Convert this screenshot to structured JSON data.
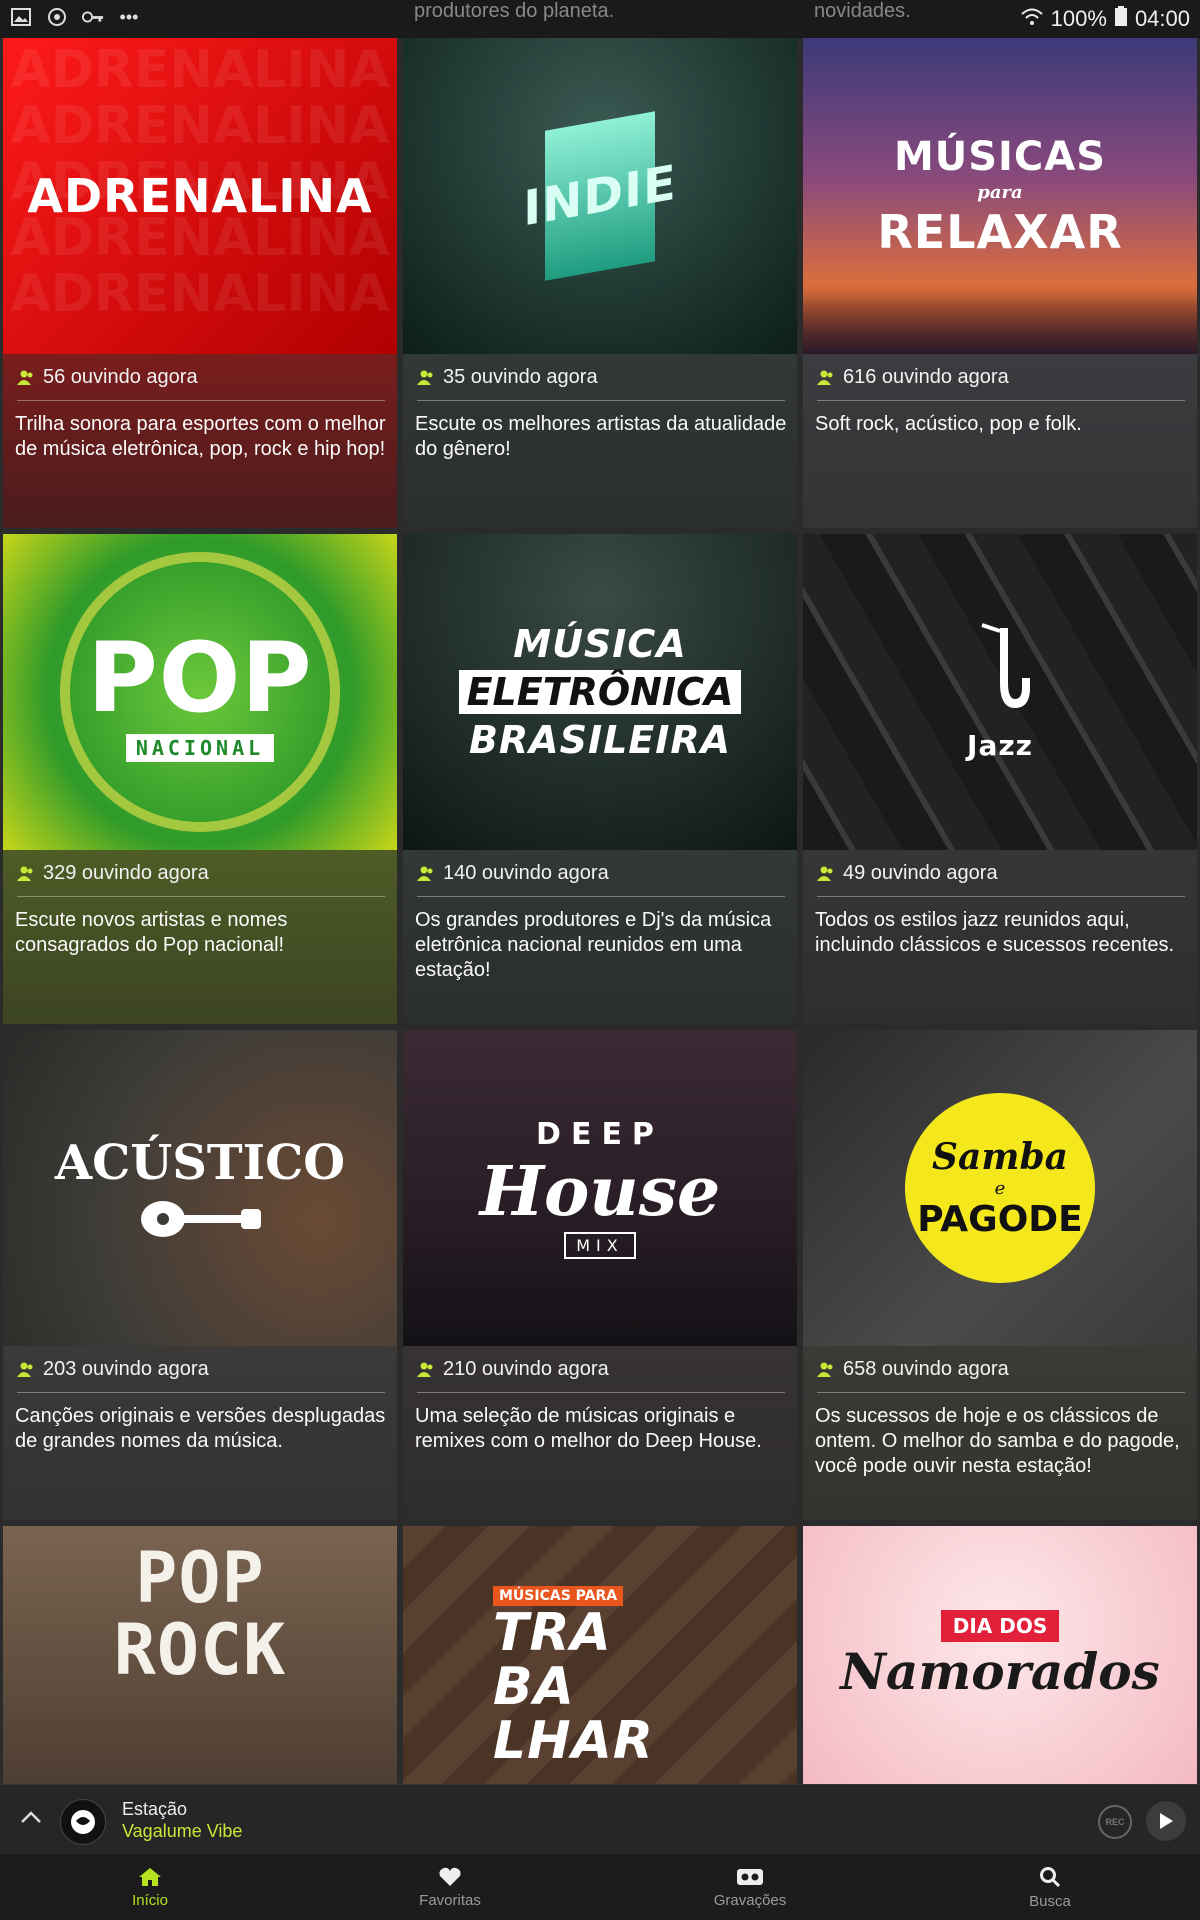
{
  "status_bar": {
    "battery": "100%",
    "time": "04:00",
    "peek_left": "produtores do planeta.",
    "peek_right": "novidades."
  },
  "cards": [
    {
      "art_title": "ADRENALINA",
      "art_bg": "#d11010",
      "info_bg": "#6f1c1c",
      "listeners": "56 ouvindo agora",
      "description": "Trilha sonora para esportes com o melhor de música eletrônica, pop, rock e hip hop!"
    },
    {
      "art_title": "INDIE",
      "art_bg": "#12302b",
      "info_bg": "#2e3432",
      "listeners": "35 ouvindo agora",
      "description": "Escute os melhores artistas da atualidade do gênero!"
    },
    {
      "art_title": "MÚSICAS",
      "art_subtitle": "para",
      "art_title2": "RELAXAR",
      "art_bg": "#5a3a78",
      "info_bg": "#3a3a3e",
      "listeners": "616 ouvindo agora",
      "description": "Soft rock, acústico, pop e folk."
    },
    {
      "art_title": "POP",
      "art_subtitle": "NACIONAL",
      "art_bg": "#3fae2e",
      "info_bg": "#4a5a24",
      "listeners": "329 ouvindo agora",
      "description": "Escute novos artistas e nomes consagrados do Pop nacional!"
    },
    {
      "art_title": "MÚSICA",
      "art_title2": "ELETRÔNICA",
      "art_title3": "BRASILEIRA",
      "art_bg": "#0f1e1a",
      "info_bg": "#2e3432",
      "listeners": "140 ouvindo agora",
      "description": "Os grandes produtores e Dj's da música eletrônica nacional reunidos em uma estação!"
    },
    {
      "art_title": "Jazz",
      "art_bg": "#2a2a2a",
      "info_bg": "#333333",
      "listeners": "49 ouvindo agora",
      "description": "Todos os estilos jazz reunidos aqui, incluindo clássicos e sucessos recentes."
    },
    {
      "art_title": "ACÚSTICO",
      "art_bg": "#4a4640",
      "info_bg": "#3a3836",
      "listeners": "203 ouvindo agora",
      "description": "Canções originais e versões desplugadas de grandes nomes da música."
    },
    {
      "art_title": "DEEP",
      "art_title2": "House",
      "art_subtitle": "MIX",
      "art_bg": "#2a1f26",
      "info_bg": "#333033",
      "listeners": "210 ouvindo agora",
      "description": "Uma seleção de músicas originais e remixes com o melhor do Deep House."
    },
    {
      "art_title": "Samba",
      "art_subtitle": "e",
      "art_title2": "PAGODE",
      "art_bg": "#3a3a3a",
      "info_bg": "#3a3a34",
      "listeners": "658 ouvindo agora",
      "description": "Os sucessos de hoje e os clássicos de ontem. O melhor do samba e do pagode, você pode ouvir nesta estação!"
    },
    {
      "art_title": "POP",
      "art_title2": "ROCK",
      "art_bg": "#6a5646"
    },
    {
      "art_title": "MÚSICAS PARA",
      "art_title2": "TRA",
      "art_title3": "BA",
      "art_title4": "LHAR",
      "art_bg": "#4a3528"
    },
    {
      "art_title": "DIA DOS",
      "art_title2": "Namorados",
      "art_bg": "#f6c9cf"
    }
  ],
  "player": {
    "label": "Estação",
    "station": "Vagalume Vibe",
    "rec": "REC"
  },
  "nav": {
    "items": [
      {
        "label": "Início",
        "icon": "home-icon"
      },
      {
        "label": "Favoritas",
        "icon": "heart-icon"
      },
      {
        "label": "Gravações",
        "icon": "recordings-icon"
      },
      {
        "label": "Busca",
        "icon": "search-icon"
      }
    ],
    "active_color": "#b6e21f"
  }
}
